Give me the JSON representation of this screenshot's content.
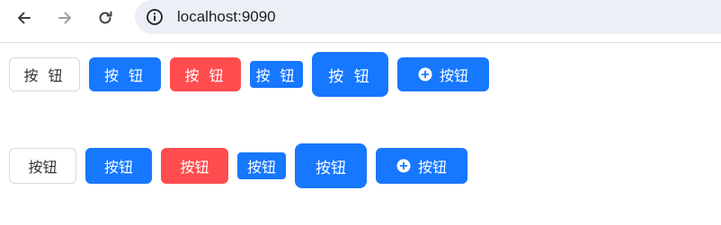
{
  "browser": {
    "url": "localhost:9090",
    "back_icon": "arrow-left-icon",
    "forward_icon": "arrow-right-icon",
    "reload_icon": "reload-icon",
    "site_info_icon": "info-circle-icon"
  },
  "rows": [
    {
      "buttons": [
        {
          "label": "按 钮",
          "variant": "default"
        },
        {
          "label": "按 钮",
          "variant": "primary"
        },
        {
          "label": "按 钮",
          "variant": "danger"
        },
        {
          "label": "按 钮",
          "variant": "primary-small"
        },
        {
          "label": "按 钮",
          "variant": "primary-large"
        },
        {
          "label": "按钮",
          "variant": "primary-with-icon",
          "icon": "plus-circle-icon"
        }
      ]
    },
    {
      "buttons": [
        {
          "label": "按钮",
          "variant": "default"
        },
        {
          "label": "按钮",
          "variant": "primary"
        },
        {
          "label": "按钮",
          "variant": "danger"
        },
        {
          "label": "按钮",
          "variant": "primary-small"
        },
        {
          "label": "按钮",
          "variant": "primary-large"
        },
        {
          "label": "按钮",
          "variant": "primary-with-icon",
          "icon": "plus-circle-icon"
        }
      ]
    }
  ],
  "colors": {
    "primary": "#1677ff",
    "danger": "#ff4d4f",
    "default_border": "#d9d9d9"
  }
}
